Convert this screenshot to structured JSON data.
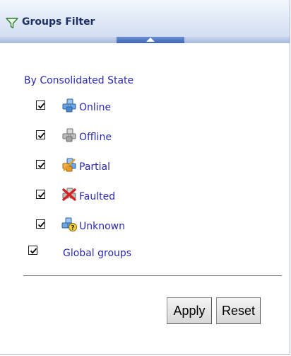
{
  "panel": {
    "title": "Groups Filter",
    "icons": {
      "header": "funnel-icon",
      "collapse": "collapse-up-arrow-icon"
    }
  },
  "section": {
    "title": "By Consolidated State",
    "states": [
      {
        "label": "Online",
        "checked": true,
        "icon": "online-group-icon"
      },
      {
        "label": "Offline",
        "checked": true,
        "icon": "offline-group-icon"
      },
      {
        "label": "Partial",
        "checked": true,
        "icon": "partial-group-icon"
      },
      {
        "label": "Faulted",
        "checked": true,
        "icon": "faulted-group-icon"
      },
      {
        "label": "Unknown",
        "checked": true,
        "icon": "unknown-group-icon"
      }
    ]
  },
  "global_groups": {
    "label": "Global groups",
    "checked": true
  },
  "buttons": {
    "apply": "Apply",
    "reset": "Reset"
  },
  "colors": {
    "link_text": "#2a2ab3",
    "header_title": "#1d2f63",
    "handle": "#3f66b7"
  }
}
